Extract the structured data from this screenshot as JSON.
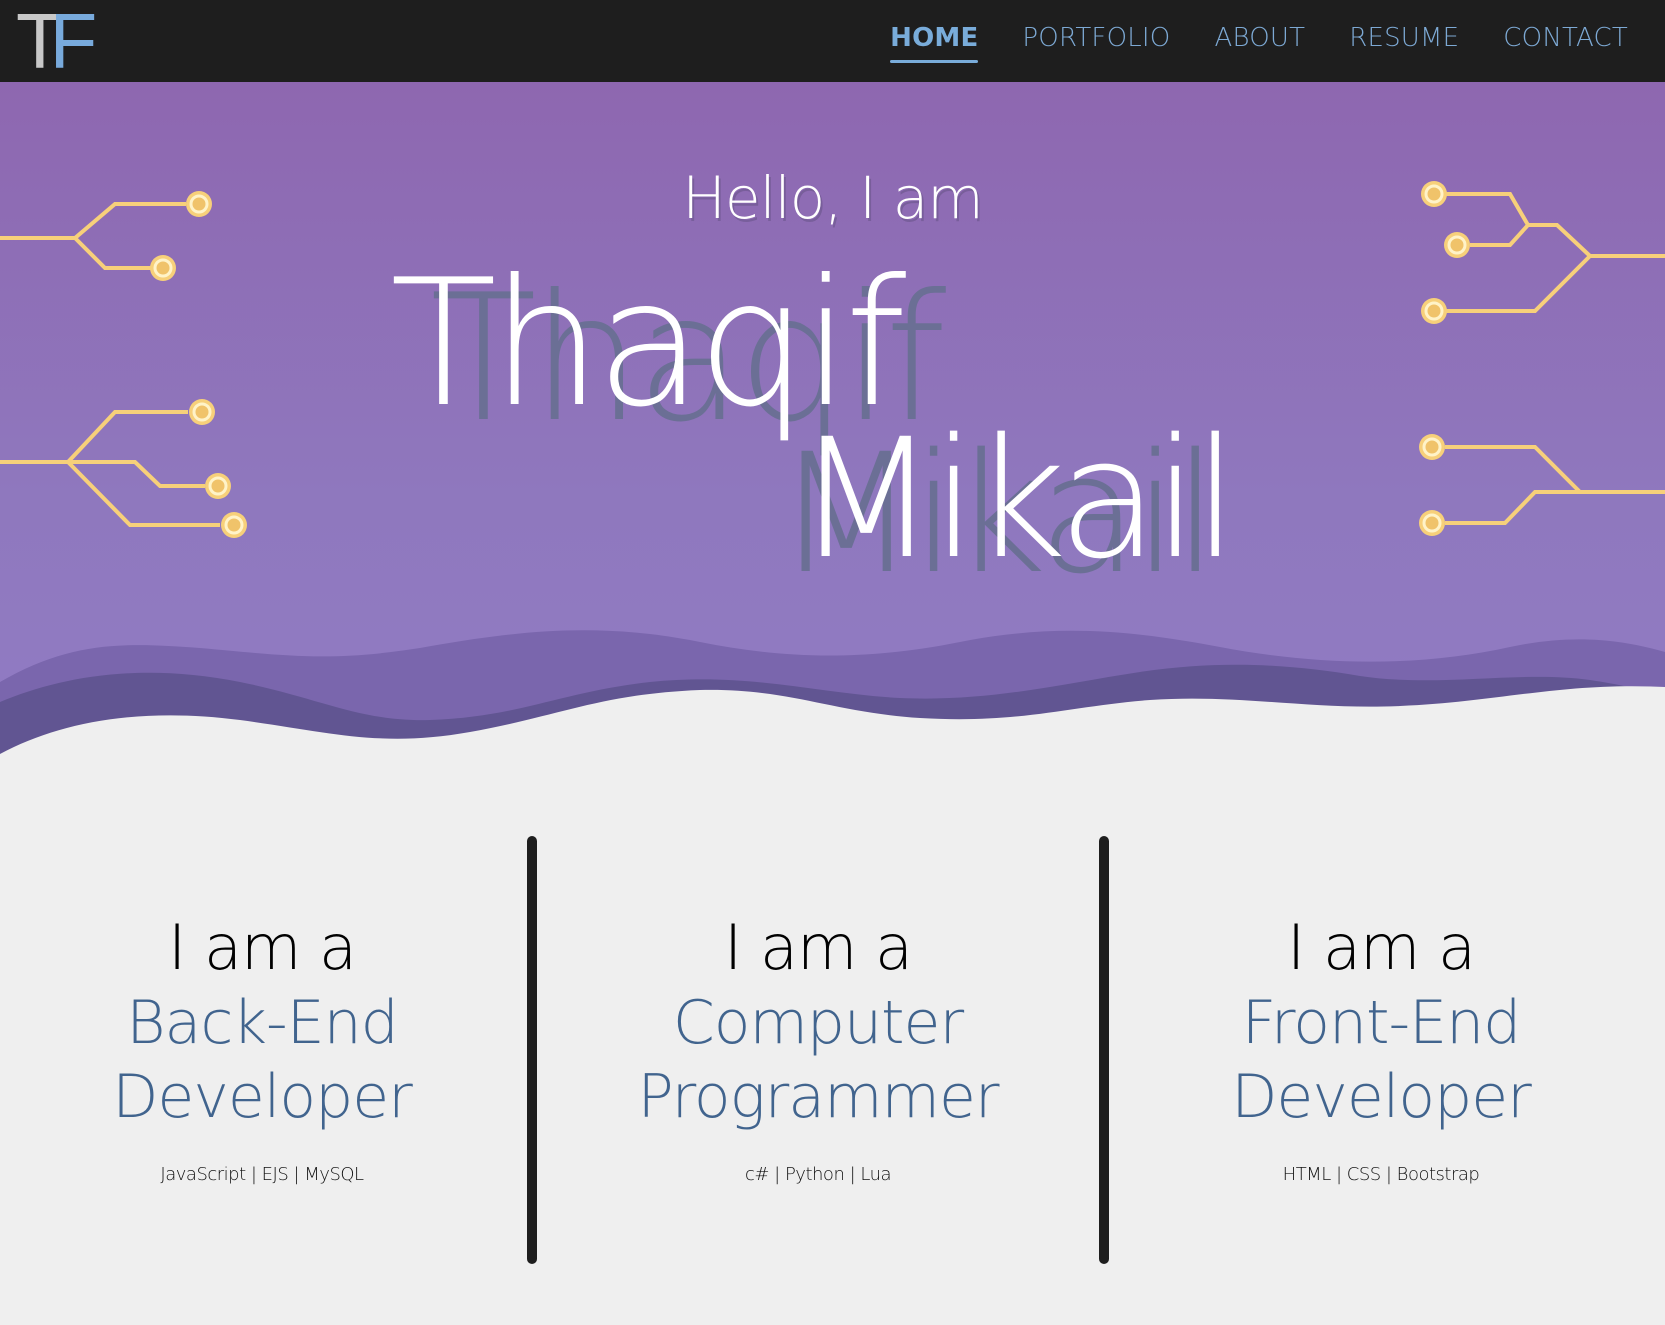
{
  "logo": {
    "letter1": "T",
    "letter2": "F"
  },
  "nav": {
    "items": [
      {
        "label": "HOME",
        "active": true
      },
      {
        "label": "PORTFOLIO",
        "active": false
      },
      {
        "label": "ABOUT",
        "active": false
      },
      {
        "label": "RESUME",
        "active": false
      },
      {
        "label": "CONTACT",
        "active": false
      }
    ]
  },
  "hero": {
    "greeting": "Hello, I am",
    "first_name": "Thaqif",
    "last_name": "Mikail"
  },
  "skills": [
    {
      "lead": "I am a",
      "role_line1": "Back-End",
      "role_line2": "Developer",
      "tech": "JavaScript | EJS | MySQL"
    },
    {
      "lead": "I am a",
      "role_line1": "Computer",
      "role_line2": "Programmer",
      "tech": "c# | Python | Lua"
    },
    {
      "lead": "I am a",
      "role_line1": "Front-End",
      "role_line2": "Developer",
      "tech": "HTML | CSS | Bootstrap"
    }
  ],
  "colors": {
    "navbar": "#1e1e1e",
    "nav_link": "#7da9d4",
    "hero_top": "#8e67b0",
    "hero_bottom": "#917cc4",
    "circuit": "#f7d07a",
    "role_text": "#41648e",
    "page_bg": "#efefef"
  },
  "icons": [
    "circuit-trace-icon"
  ]
}
